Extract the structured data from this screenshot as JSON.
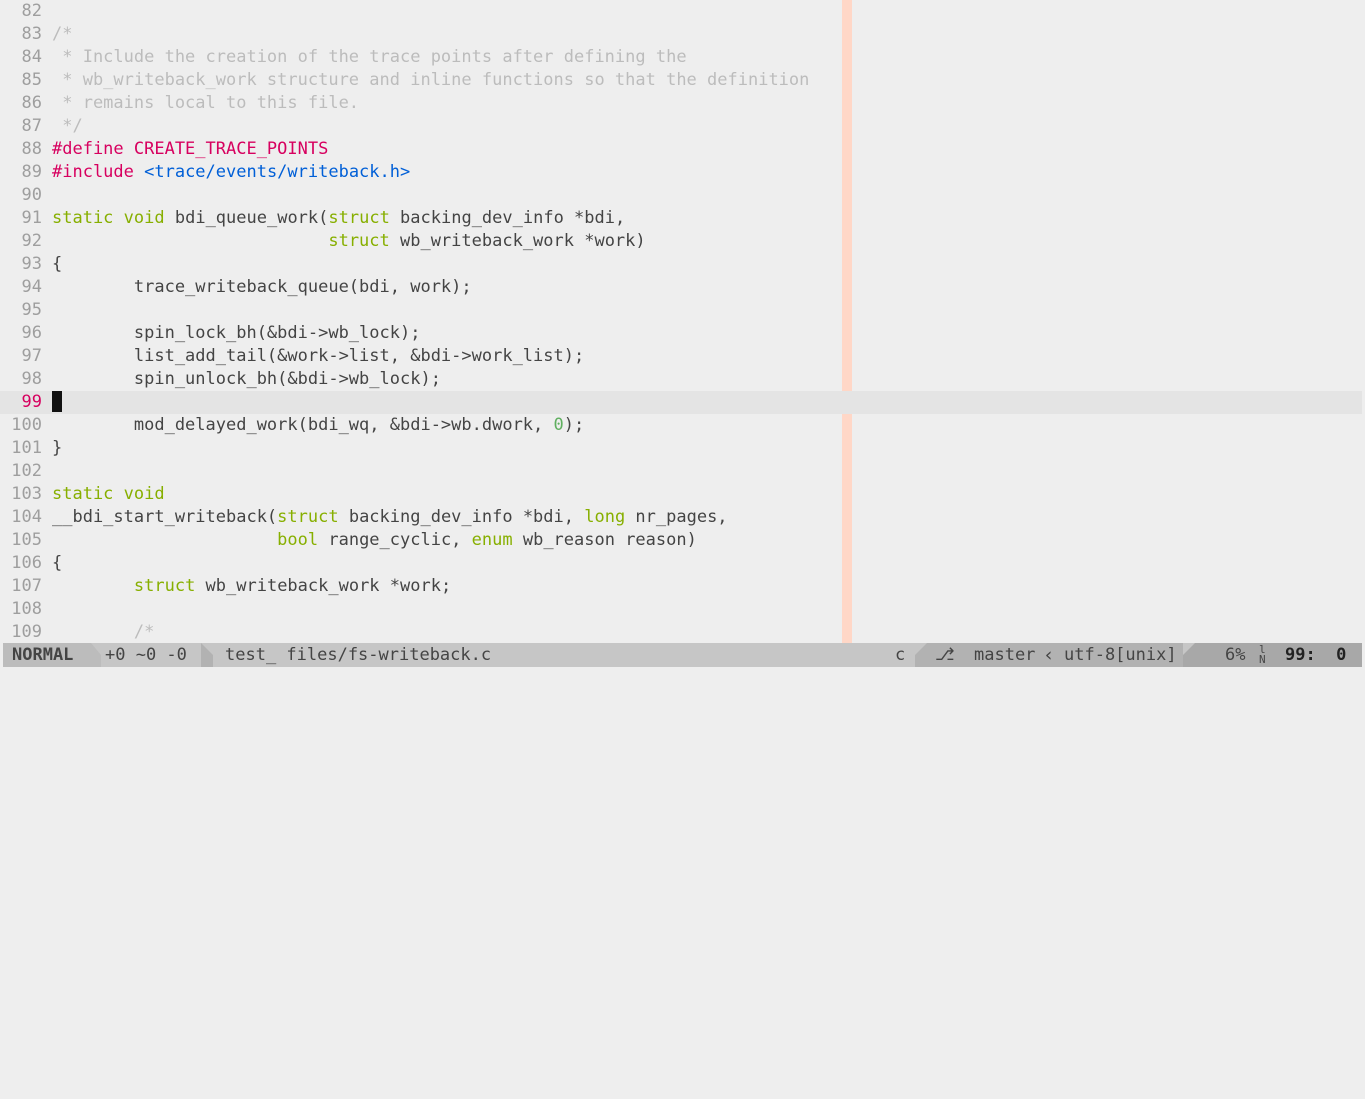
{
  "editor": {
    "lines": [
      {
        "n": "82",
        "tokens": []
      },
      {
        "n": "83",
        "tokens": [
          {
            "t": "/*",
            "c": "c-comment"
          }
        ]
      },
      {
        "n": "84",
        "tokens": [
          {
            "t": " * Include the creation of the trace points after defining the",
            "c": "c-comment"
          }
        ]
      },
      {
        "n": "85",
        "tokens": [
          {
            "t": " * wb_writeback_work structure and inline functions so that the definition",
            "c": "c-comment"
          }
        ]
      },
      {
        "n": "86",
        "tokens": [
          {
            "t": " * remains local to this file.",
            "c": "c-comment"
          }
        ]
      },
      {
        "n": "87",
        "tokens": [
          {
            "t": " */",
            "c": "c-comment"
          }
        ]
      },
      {
        "n": "88",
        "tokens": [
          {
            "t": "#define CREATE_TRACE_POINTS",
            "c": "c-pre"
          }
        ]
      },
      {
        "n": "89",
        "tokens": [
          {
            "t": "#include ",
            "c": "c-pre"
          },
          {
            "t": "<trace/events/writeback.h>",
            "c": "c-str"
          }
        ]
      },
      {
        "n": "90",
        "tokens": []
      },
      {
        "n": "91",
        "tokens": [
          {
            "t": "static",
            "c": "c-kw"
          },
          {
            "t": " ",
            "c": "c-text"
          },
          {
            "t": "void",
            "c": "c-kw"
          },
          {
            "t": " bdi_queue_work(",
            "c": "c-text"
          },
          {
            "t": "struct",
            "c": "c-kw"
          },
          {
            "t": " backing_dev_info *bdi,",
            "c": "c-text"
          }
        ]
      },
      {
        "n": "92",
        "tokens": [
          {
            "t": "                           ",
            "c": "c-text"
          },
          {
            "t": "struct",
            "c": "c-kw"
          },
          {
            "t": " wb_writeback_work *work)",
            "c": "c-text"
          }
        ]
      },
      {
        "n": "93",
        "tokens": [
          {
            "t": "{",
            "c": "c-text"
          }
        ]
      },
      {
        "n": "94",
        "tokens": [
          {
            "t": "        trace_writeback_queue(bdi, work);",
            "c": "c-text"
          }
        ]
      },
      {
        "n": "95",
        "tokens": []
      },
      {
        "n": "96",
        "tokens": [
          {
            "t": "        spin_lock_bh(&bdi->wb_lock);",
            "c": "c-text"
          }
        ]
      },
      {
        "n": "97",
        "tokens": [
          {
            "t": "        list_add_tail(&work->list, &bdi->work_list);",
            "c": "c-text"
          }
        ]
      },
      {
        "n": "98",
        "tokens": [
          {
            "t": "        spin_unlock_bh(&bdi->wb_lock);",
            "c": "c-text"
          }
        ]
      },
      {
        "n": "99",
        "tokens": [],
        "cursor": true
      },
      {
        "n": "100",
        "tokens": [
          {
            "t": "        mod_delayed_work(bdi_wq, &bdi->wb.dwork, ",
            "c": "c-text"
          },
          {
            "t": "0",
            "c": "c-num"
          },
          {
            "t": ");",
            "c": "c-text"
          }
        ]
      },
      {
        "n": "101",
        "tokens": [
          {
            "t": "}",
            "c": "c-text"
          }
        ]
      },
      {
        "n": "102",
        "tokens": []
      },
      {
        "n": "103",
        "tokens": [
          {
            "t": "static",
            "c": "c-kw"
          },
          {
            "t": " ",
            "c": "c-text"
          },
          {
            "t": "void",
            "c": "c-kw"
          }
        ]
      },
      {
        "n": "104",
        "tokens": [
          {
            "t": "__bdi_start_writeback(",
            "c": "c-text"
          },
          {
            "t": "struct",
            "c": "c-kw"
          },
          {
            "t": " backing_dev_info *bdi, ",
            "c": "c-text"
          },
          {
            "t": "long",
            "c": "c-kw"
          },
          {
            "t": " nr_pages,",
            "c": "c-text"
          }
        ]
      },
      {
        "n": "105",
        "tokens": [
          {
            "t": "                      ",
            "c": "c-text"
          },
          {
            "t": "bool",
            "c": "c-kw"
          },
          {
            "t": " range_cyclic, ",
            "c": "c-text"
          },
          {
            "t": "enum",
            "c": "c-kw"
          },
          {
            "t": " wb_reason reason)",
            "c": "c-text"
          }
        ]
      },
      {
        "n": "106",
        "tokens": [
          {
            "t": "{",
            "c": "c-text"
          }
        ]
      },
      {
        "n": "107",
        "tokens": [
          {
            "t": "        ",
            "c": "c-text"
          },
          {
            "t": "struct",
            "c": "c-kw"
          },
          {
            "t": " wb_writeback_work *work;",
            "c": "c-text"
          }
        ]
      },
      {
        "n": "108",
        "tokens": []
      },
      {
        "n": "109",
        "tokens": [
          {
            "t": "        /*",
            "c": "c-comment"
          }
        ]
      }
    ]
  },
  "statusline": {
    "mode": "NORMAL",
    "diff": "+0 ~0 -0",
    "filename": "test_ files/fs-writeback.c",
    "filetype": "c",
    "branch_icon": "⎇",
    "branch": "master",
    "encoding": "utf-8[unix]",
    "percent": "6%",
    "ln_icon": "ln-icon",
    "position": "99:  0"
  },
  "colors": {
    "background": "#eeeeee",
    "colorcolumn": "#ffd7c7",
    "keyword": "#87af00",
    "preproc": "#d7005f",
    "string": "#005fd7",
    "comment": "#bcbcbc"
  }
}
